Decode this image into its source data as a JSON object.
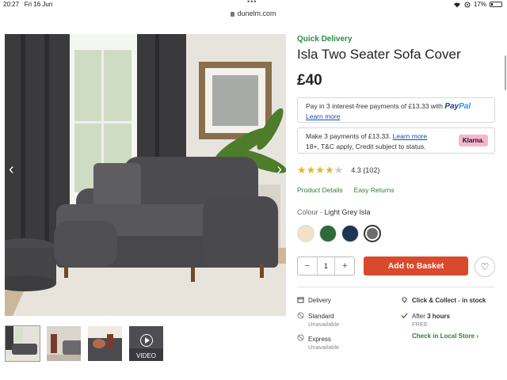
{
  "status": {
    "time": "20:27",
    "date": "Fri 16 Jun",
    "battery": "17%",
    "dots": "•••"
  },
  "browser": {
    "url": "dunelm.com"
  },
  "product": {
    "badge": "Quick Delivery",
    "title": "Isla Two Seater Sofa Cover",
    "price": "£40"
  },
  "paypal": {
    "text": "Pay in 3 interest-free payments of £13.33 with",
    "brand_pay": "Pay",
    "brand_pal": "Pal",
    "link": "Learn more"
  },
  "klarna": {
    "text": "Make 3 payments of £13.33.",
    "link": "Learn more",
    "subtext": "18+, T&C apply, Credit subject to status.",
    "badge": "Klarna."
  },
  "rating": {
    "stars_value": 4.3,
    "stars": "★★★★",
    "half_star": "★",
    "score": "4.3",
    "count": "(102)"
  },
  "tabs": {
    "details": "Product Details",
    "returns": "Easy Returns"
  },
  "colour": {
    "label": "Colour - ",
    "value": "Light Grey Isla",
    "swatches": [
      "#f1e2c6",
      "#2e6b3a",
      "#1f3554",
      "#6c6c6c"
    ],
    "selected_index": 3
  },
  "basket": {
    "minus": "−",
    "quantity": "1",
    "plus": "+",
    "add_label": "Add to Basket",
    "wishlist_icon": "heart-icon"
  },
  "delivery": {
    "heading": "Delivery",
    "standard_label": "Standard",
    "standard_status": "Unavailable",
    "express_label": "Express",
    "express_status": "Unavailable"
  },
  "click_collect": {
    "heading": "Click & Collect",
    "heading_suffix": " - in stock",
    "after_prefix": "After ",
    "after_time": "3 hours",
    "cost": "FREE",
    "check_local": "Check in Local Store",
    "check_arrow": "›"
  },
  "gallery": {
    "video_label": "VIDEO",
    "prev_arrow": "‹",
    "next_arrow": "›"
  },
  "colors": {
    "accent": "#d9492b",
    "green": "#2e7d32",
    "star": "#e9b61f"
  }
}
